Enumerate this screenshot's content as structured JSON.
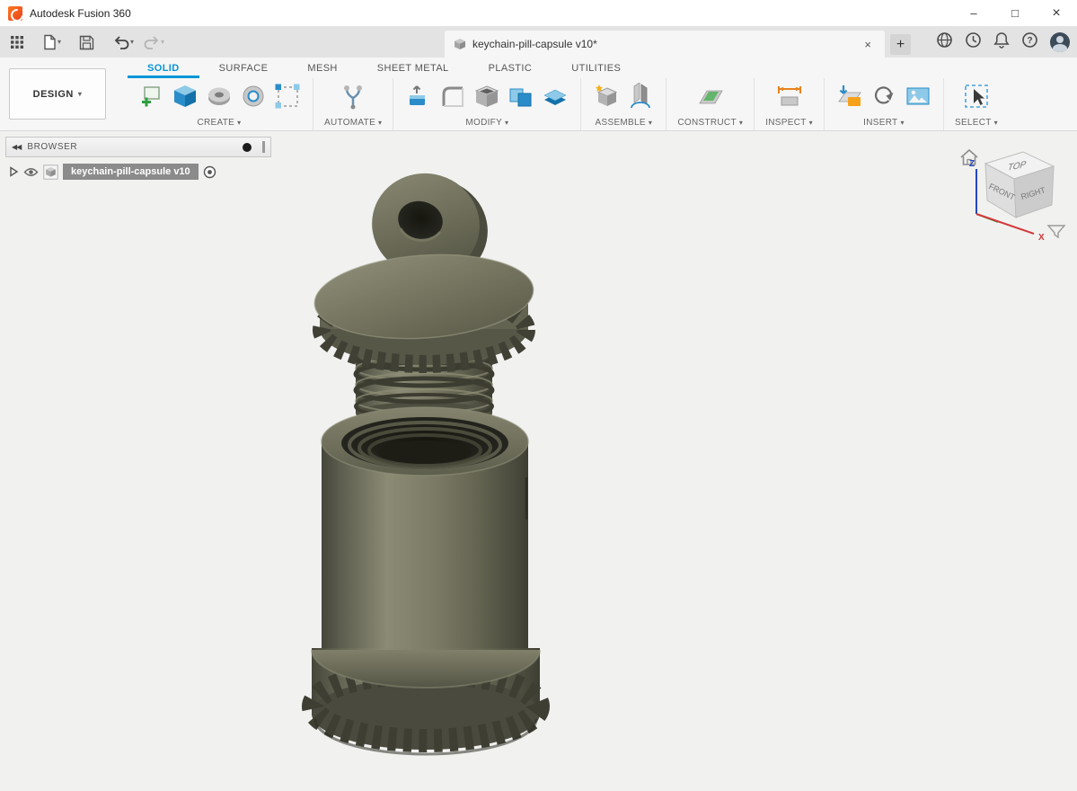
{
  "window": {
    "title": "Autodesk Fusion 360",
    "minimize_glyph": "–",
    "maximize_glyph": "□",
    "close_glyph": "×"
  },
  "quick_toolbar": {
    "document_tab": {
      "label": "keychain-pill-capsule v10*",
      "close_glyph": "×"
    },
    "new_tab_glyph": "+",
    "dropdown_glyph": "▾"
  },
  "ribbon": {
    "workspace_label": "DESIGN",
    "dropdown_glyph": "▾",
    "tabs": [
      {
        "label": "SOLID",
        "active": true
      },
      {
        "label": "SURFACE",
        "active": false
      },
      {
        "label": "MESH",
        "active": false
      },
      {
        "label": "SHEET METAL",
        "active": false
      },
      {
        "label": "PLASTIC",
        "active": false
      },
      {
        "label": "UTILITIES",
        "active": false
      }
    ],
    "groups": [
      {
        "label": "CREATE"
      },
      {
        "label": "AUTOMATE"
      },
      {
        "label": "MODIFY"
      },
      {
        "label": "ASSEMBLE"
      },
      {
        "label": "CONSTRUCT"
      },
      {
        "label": "INSPECT"
      },
      {
        "label": "INSERT"
      },
      {
        "label": "SELECT"
      }
    ]
  },
  "browser": {
    "title": "BROWSER",
    "item_label": "keychain-pill-capsule v10"
  },
  "viewcube": {
    "top": "TOP",
    "front": "FRONT",
    "right": "RIGHT",
    "axis_x": "X",
    "axis_z": "Z"
  },
  "icons": {
    "help_glyph": "?"
  },
  "colors": {
    "accent_blue": "#0696d7",
    "model_olive": "#73735f",
    "axis_x_red": "#d23737",
    "axis_z_blue": "#2447c4",
    "logo_orange": "#e8401c"
  }
}
